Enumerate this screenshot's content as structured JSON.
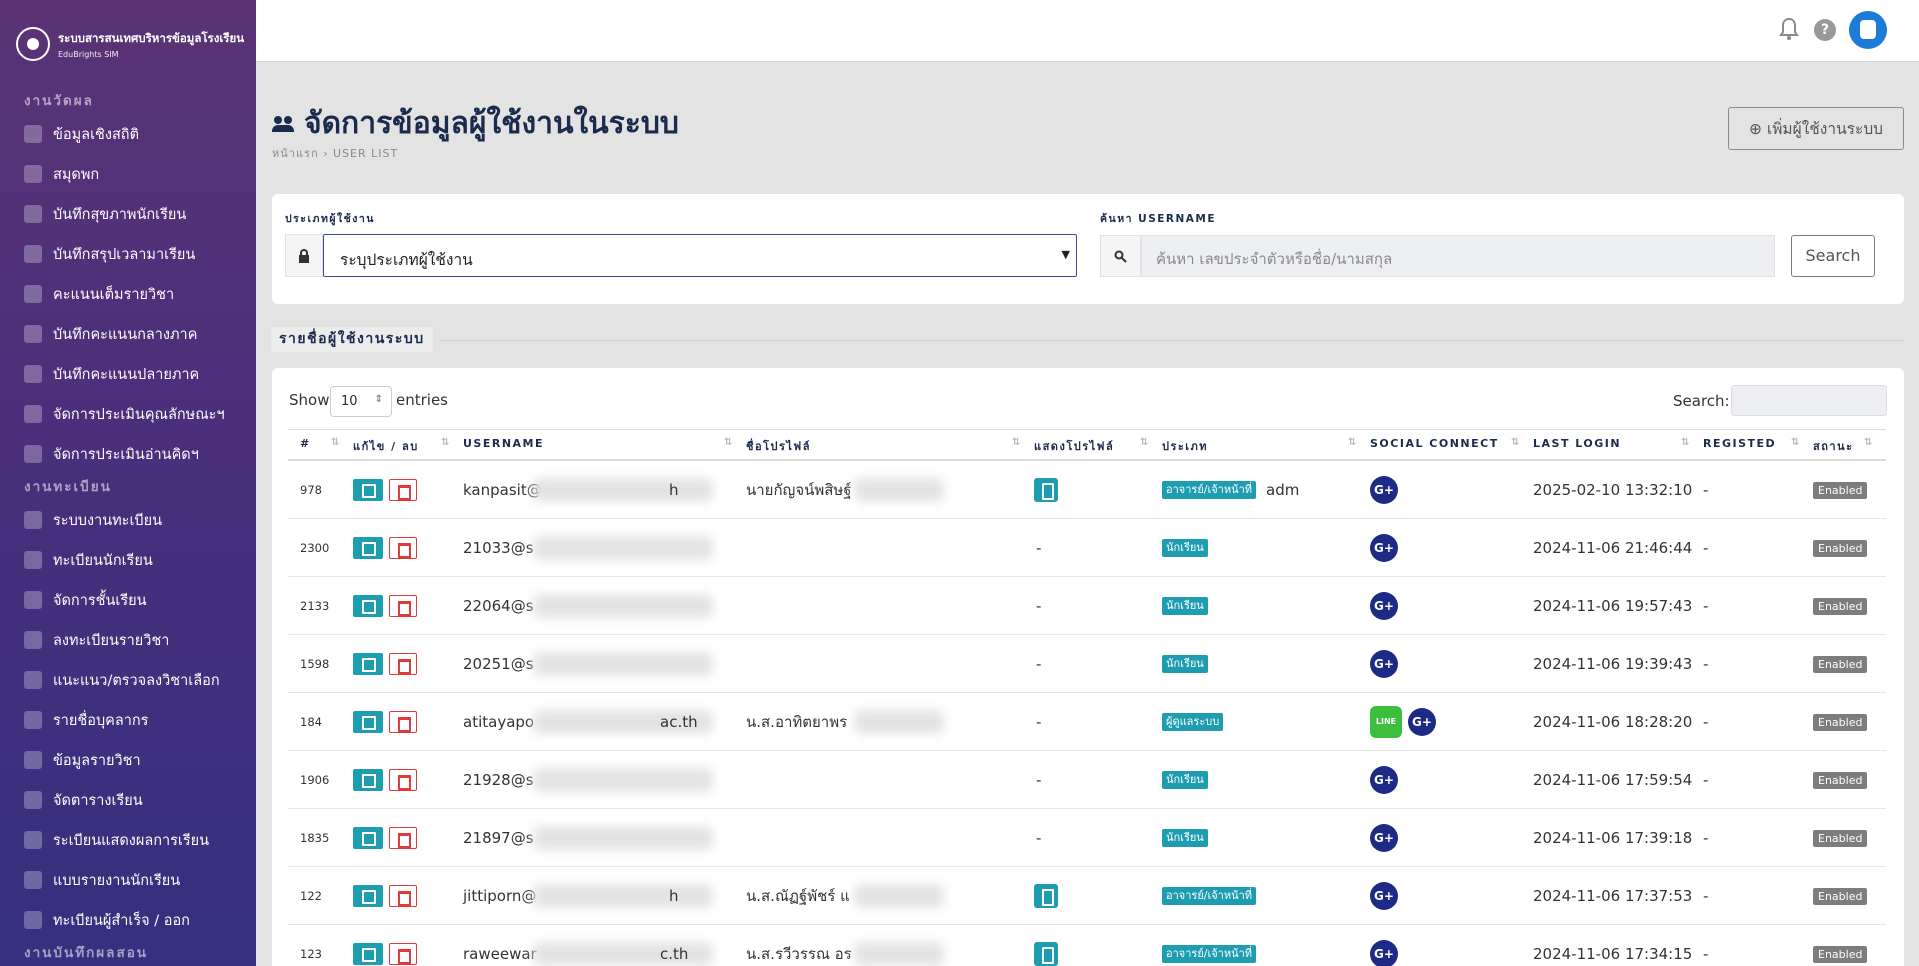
{
  "brand": {
    "title": "ระบบสารสนเทศบริหารข้อมูลโรงเรียน",
    "subtitle": "EduBrights SIM"
  },
  "sidebar": {
    "sections": [
      {
        "label": "งานวัดผล",
        "items": [
          "ข้อมูลเชิงสถิติ",
          "สมุดพก",
          "บันทึกสุขภาพนักเรียน",
          "บันทึกสรุปเวลามาเรียน",
          "คะแนนเต็มรายวิชา",
          "บันทึกคะแนนกลางภาค",
          "บันทึกคะแนนปลายภาค",
          "จัดการประเมินคุณลักษณะฯ",
          "จัดการประเมินอ่านคิดฯ"
        ]
      },
      {
        "label": "งานทะเบียน",
        "items": [
          "ระบบงานทะเบียน",
          "ทะเบียนนักเรียน",
          "จัดการชั้นเรียน",
          "ลงทะเบียนรายวิชา",
          "แนะแนว/ตรวจลงวิชาเลือก",
          "รายชื่อบุคลากร",
          "ข้อมูลรายวิชา",
          "จัดตารางเรียน",
          "ระเบียนแสดงผลการเรียน",
          "แบบรายงานนักเรียน",
          "ทะเบียนผู้สำเร็จ / ออก"
        ]
      },
      {
        "label": "งานบันทึกผลสอน",
        "items": []
      }
    ]
  },
  "topbar": {
    "help": "?"
  },
  "page": {
    "title": "จัดการข้อมูลผู้ใช้งานในระบบ",
    "breadcrumb_home": "หน้าแรก",
    "breadcrumb_sep": "›",
    "breadcrumb_current": "USER LIST",
    "add_button": "⊕ เพิ่มผู้ใช้งานระบบ"
  },
  "filter": {
    "type_label": "ประเภทผู้ใช้งาน",
    "type_value": "ระบุประเภทผู้ใช้งาน",
    "search_label": "ค้นหา USERNAME",
    "search_placeholder": "ค้นหา เลขประจำตัวหรือชื่อ/นามสกุล",
    "search_button": "Search"
  },
  "list": {
    "title": "รายชื่อผู้ใช้งานระบบ",
    "show": "Show",
    "entries_value": "10",
    "entries": "entries",
    "search": "Search:"
  },
  "columns": [
    "#",
    "แก้ไข / ลบ",
    "USERNAME",
    "ชื่อโปรไฟล์",
    "แสดงโปรไฟล์",
    "ประเภท",
    "SOCIAL CONNECT",
    "LAST LOGIN",
    "REGISTED",
    "สถานะ"
  ],
  "rows": [
    {
      "id": "978",
      "user_a": "kanpasit@",
      "user_b": "h",
      "name": "นายกัญจน์พสิษฐ์",
      "show": "icon",
      "type": "อาจารย์/เจ้าหน้าที่",
      "type_extra": "adm",
      "line": false,
      "login": "2025-02-10 13:32:10",
      "reg": "-",
      "status": "Enabled"
    },
    {
      "id": "2300",
      "user_a": "21033@s",
      "user_b": "",
      "name": "",
      "show": "-",
      "type": "นักเรียน",
      "type_extra": "",
      "line": false,
      "login": "2024-11-06 21:46:44",
      "reg": "-",
      "status": "Enabled"
    },
    {
      "id": "2133",
      "user_a": "22064@s",
      "user_b": "",
      "name": "",
      "show": "-",
      "type": "นักเรียน",
      "type_extra": "",
      "line": false,
      "login": "2024-11-06 19:57:43",
      "reg": "-",
      "status": "Enabled"
    },
    {
      "id": "1598",
      "user_a": "20251@s",
      "user_b": "",
      "name": "",
      "show": "-",
      "type": "นักเรียน",
      "type_extra": "",
      "line": false,
      "login": "2024-11-06 19:39:43",
      "reg": "-",
      "status": "Enabled"
    },
    {
      "id": "184",
      "user_a": "atitayapo",
      "user_b": "ac.th",
      "name": "น.ส.อาทิตยาพร",
      "show": "-",
      "type": "ผู้ดูแลระบบ",
      "type_extra": "",
      "line": true,
      "login": "2024-11-06 18:28:20",
      "reg": "-",
      "status": "Enabled"
    },
    {
      "id": "1906",
      "user_a": "21928@s",
      "user_b": "",
      "name": "",
      "show": "-",
      "type": "นักเรียน",
      "type_extra": "",
      "line": false,
      "login": "2024-11-06 17:59:54",
      "reg": "-",
      "status": "Enabled"
    },
    {
      "id": "1835",
      "user_a": "21897@s",
      "user_b": "",
      "name": "",
      "show": "-",
      "type": "นักเรียน",
      "type_extra": "",
      "line": false,
      "login": "2024-11-06 17:39:18",
      "reg": "-",
      "status": "Enabled"
    },
    {
      "id": "122",
      "user_a": "jittiporn@",
      "user_b": "h",
      "name": "น.ส.ณัฏฐ์พัชร์ แ",
      "show": "icon",
      "type": "อาจารย์/เจ้าหน้าที่",
      "type_extra": "",
      "line": false,
      "login": "2024-11-06 17:37:53",
      "reg": "-",
      "status": "Enabled"
    },
    {
      "id": "123",
      "user_a": "raweewar",
      "user_b": "c.th",
      "name": "น.ส.รวีวรรณ อร",
      "show": "icon",
      "type": "อาจารย์/เจ้าหน้าที่",
      "type_extra": "",
      "line": false,
      "login": "2024-11-06 17:34:15",
      "reg": "-",
      "status": "Enabled"
    }
  ],
  "social": {
    "google": "G+",
    "line": "LINE"
  },
  "colors": {
    "sidebar_top": "#5b3375",
    "sidebar_bottom": "#35307f",
    "accent": "#1e9db0",
    "google": "#1d2b86",
    "line": "#3dbe3d",
    "enabled": "#7d7d7d",
    "danger": "#e03a3a",
    "heading": "#1b2b4e"
  }
}
